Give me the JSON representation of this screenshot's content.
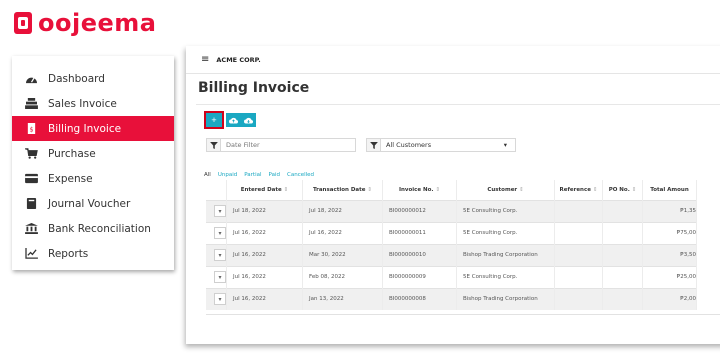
{
  "brand": {
    "name": "oojeema",
    "color": "#e8103a"
  },
  "sidebar": {
    "items": [
      {
        "label": "Dashboard",
        "icon": "dashboard-icon",
        "active": false
      },
      {
        "label": "Sales Invoice",
        "icon": "cash-register-icon",
        "active": false
      },
      {
        "label": "Billing Invoice",
        "icon": "invoice-icon",
        "active": true
      },
      {
        "label": "Purchase",
        "icon": "cart-icon",
        "active": false
      },
      {
        "label": "Expense",
        "icon": "credit-card-icon",
        "active": false
      },
      {
        "label": "Journal Voucher",
        "icon": "book-icon",
        "active": false
      },
      {
        "label": "Bank Reconciliation",
        "icon": "bank-icon",
        "active": false
      },
      {
        "label": "Reports",
        "icon": "line-chart-icon",
        "active": false
      }
    ]
  },
  "topbar": {
    "company": "ACME CORP."
  },
  "page": {
    "title": "Billing Invoice"
  },
  "toolbar": {
    "add_label": "+",
    "accent": "#1aa8c2"
  },
  "filters": {
    "date_placeholder": "Date Filter",
    "customer_select": "All Customers"
  },
  "tabs": [
    {
      "label": "All",
      "active": true
    },
    {
      "label": "Unpaid",
      "active": false
    },
    {
      "label": "Partial",
      "active": false
    },
    {
      "label": "Paid",
      "active": false
    },
    {
      "label": "Cancelled",
      "active": false
    }
  ],
  "table": {
    "columns": [
      "",
      "Entered Date",
      "Transaction Date",
      "Invoice No.",
      "Customer",
      "Reference",
      "PO No.",
      "Total Amoun"
    ],
    "rows": [
      {
        "entered": "Jul 18, 2022",
        "transaction": "Jul 18, 2022",
        "invoice": "BI000000012",
        "customer": "5E Consulting Corp.",
        "reference": "",
        "po": "",
        "total": "₱1,35"
      },
      {
        "entered": "Jul 16, 2022",
        "transaction": "Jul 16, 2022",
        "invoice": "BI000000011",
        "customer": "5E Consulting Corp.",
        "reference": "",
        "po": "",
        "total": "₱75,00"
      },
      {
        "entered": "Jul 16, 2022",
        "transaction": "Mar 30, 2022",
        "invoice": "BI000000010",
        "customer": "Bishop Trading Corporation",
        "reference": "",
        "po": "",
        "total": "₱3,50"
      },
      {
        "entered": "Jul 16, 2022",
        "transaction": "Feb 08, 2022",
        "invoice": "BI000000009",
        "customer": "5E Consulting Corp.",
        "reference": "",
        "po": "",
        "total": "₱25,00"
      },
      {
        "entered": "Jul 16, 2022",
        "transaction": "Jan 13, 2022",
        "invoice": "BI000000008",
        "customer": "Bishop Trading Corporation",
        "reference": "",
        "po": "",
        "total": "₱2,00"
      }
    ]
  }
}
